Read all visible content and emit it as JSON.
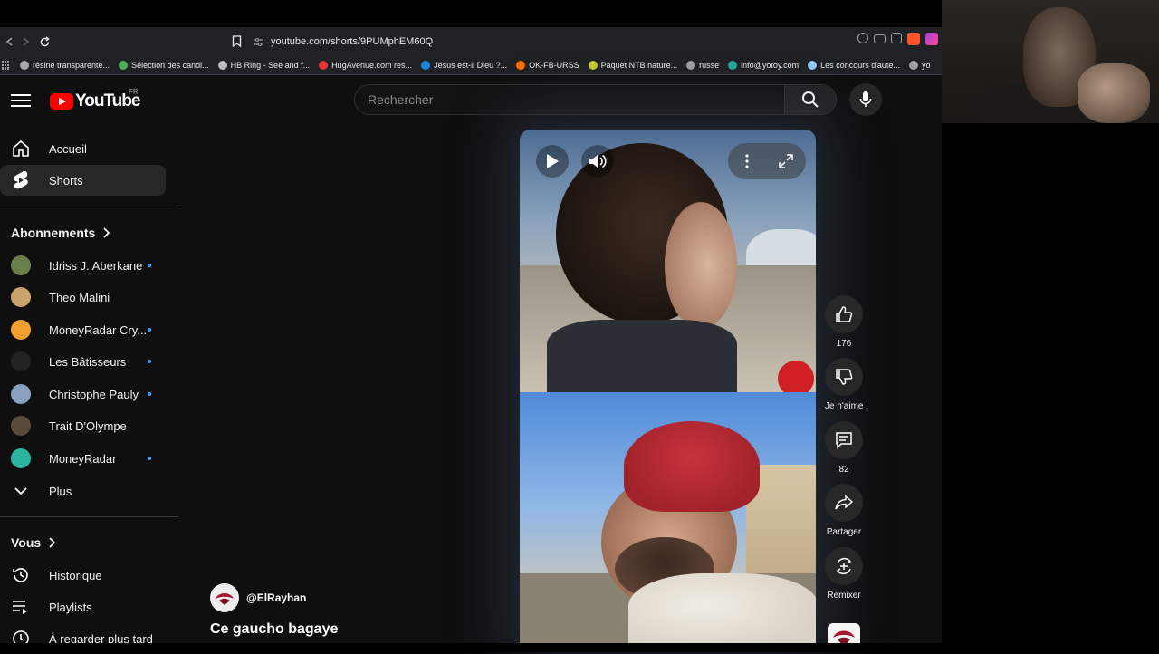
{
  "browser": {
    "url": "youtube.com/shorts/9PUMphEM60Q",
    "bookmarks": [
      {
        "label": "résine transparente...",
        "color": "#aaaaaa"
      },
      {
        "label": "Sélection des candi...",
        "color": "#4caf50"
      },
      {
        "label": "HB Ring - See and f...",
        "color": "#bbbbbb"
      },
      {
        "label": "HugAvenue.com res...",
        "color": "#e53935"
      },
      {
        "label": "Jésus est-il Dieu ?...",
        "color": "#1e88e5"
      },
      {
        "label": "OK-FB-URSS",
        "color": "#ff6d00"
      },
      {
        "label": "Paquet NTB nature...",
        "color": "#c0ca33"
      },
      {
        "label": "russe",
        "color": "#9aa0a6"
      },
      {
        "label": "info@yotoy.com",
        "color": "#26a69a"
      },
      {
        "label": "Les concours d'aute...",
        "color": "#90caf9"
      },
      {
        "label": "yo",
        "color": "#9aa0a6"
      }
    ]
  },
  "header": {
    "logo_text": "YouTube",
    "country": "FR",
    "search_placeholder": "Rechercher"
  },
  "sidebar": {
    "main": [
      {
        "label": "Accueil",
        "icon": "home-icon"
      },
      {
        "label": "Shorts",
        "icon": "shorts-icon"
      }
    ],
    "subscriptions_heading": "Abonnements",
    "subscriptions": [
      {
        "label": "Idriss J. Aberkane",
        "dot": true,
        "color": "#6b7f4a"
      },
      {
        "label": "Theo Malini",
        "dot": false,
        "color": "#c9a46a"
      },
      {
        "label": "MoneyRadar Cry...",
        "dot": true,
        "color": "#f0a030"
      },
      {
        "label": "Les Bâtisseurs",
        "dot": true,
        "color": "#222222"
      },
      {
        "label": "Christophe Pauly",
        "dot": true,
        "color": "#8aa0c0"
      },
      {
        "label": "Trait D'Olympe",
        "dot": false,
        "color": "#5a4a3a"
      },
      {
        "label": "MoneyRadar",
        "dot": true,
        "color": "#2bb5a0"
      }
    ],
    "more_label": "Plus",
    "you_heading": "Vous",
    "you_items": [
      {
        "label": "Historique",
        "icon": "history-icon"
      },
      {
        "label": "Playlists",
        "icon": "playlists-icon"
      },
      {
        "label": "À regarder plus tard",
        "icon": "watch-later-icon"
      }
    ]
  },
  "short": {
    "channel": "@ElRayhan",
    "title": "Ce gaucho bagaye",
    "likes": "176",
    "dislike_label": "Je n'aime .",
    "comments": "82",
    "share_label": "Partager",
    "remix_label": "Remixer"
  },
  "colors": {
    "accent": "#ff0000",
    "subscription_dot": "#3ea6ff",
    "background": "#0f0f0f"
  }
}
